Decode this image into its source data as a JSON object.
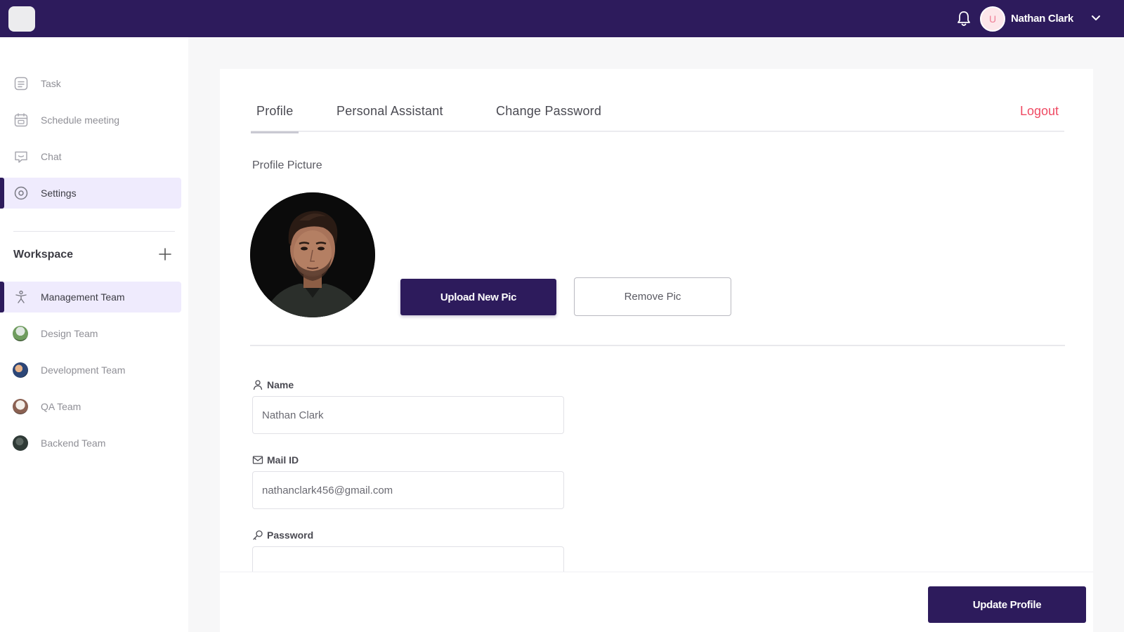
{
  "header": {
    "user_name": "Nathan Clark",
    "avatar_initial": "U"
  },
  "sidebar": {
    "nav": [
      {
        "label": "Task",
        "icon": "task-icon"
      },
      {
        "label": "Schedule meeting",
        "icon": "calendar-icon"
      },
      {
        "label": "Chat",
        "icon": "chat-icon"
      },
      {
        "label": "Settings",
        "icon": "settings-icon",
        "active": true
      }
    ],
    "workspace_title": "Workspace",
    "teams": [
      {
        "label": "Management Team",
        "icon": "team-icon",
        "active": true
      },
      {
        "label": "Design Team",
        "color": "#7fa36a"
      },
      {
        "label": "Development Team",
        "color": "#3b5fa0"
      },
      {
        "label": "QA Team",
        "color": "#9a6a5a"
      },
      {
        "label": "Backend Team",
        "color": "#2f3a36"
      }
    ]
  },
  "tabs": {
    "profile": "Profile",
    "assistant": "Personal Assistant",
    "password": "Change Password",
    "logout": "Logout"
  },
  "profile_picture": {
    "label": "Profile Picture",
    "upload_label": "Upload New Pic",
    "remove_label": "Remove Pic"
  },
  "form": {
    "name_label": "Name",
    "name_value": "Nathan Clark",
    "mail_label": "Mail ID",
    "mail_value": "nathanclark456@gmail.com",
    "password_label": "Password"
  },
  "footer": {
    "update_label": "Update Profile"
  },
  "colors": {
    "brand": "#2d1b5c",
    "active_bg": "#efebfd",
    "logout": "#ef4a63"
  }
}
